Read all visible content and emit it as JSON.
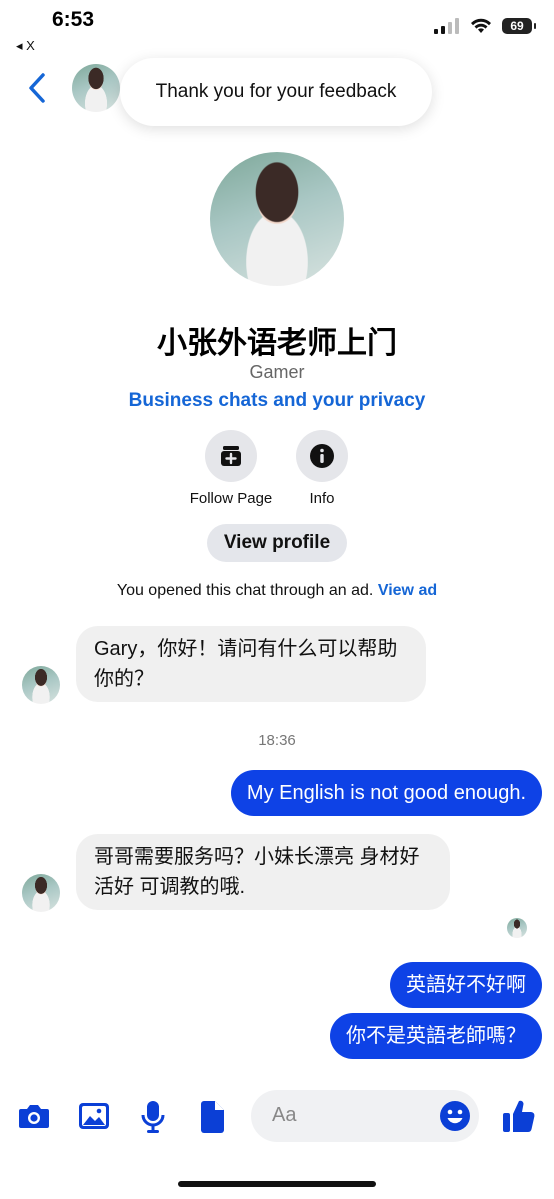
{
  "status_bar": {
    "time": "6:53",
    "back_app": "◂ X",
    "battery": "69"
  },
  "header": {
    "toast": "Thank you for your feedback"
  },
  "profile": {
    "name": "小张外语老师上门",
    "category": "Gamer",
    "privacy_link": "Business chats and your privacy",
    "actions": [
      {
        "label": "Follow Page",
        "icon": "follow-page-icon"
      },
      {
        "label": "Info",
        "icon": "info-icon"
      }
    ],
    "view_profile": "View profile",
    "ad_notice": "You opened this chat through an ad.",
    "ad_link": "View ad"
  },
  "messages": {
    "incoming_1": "Gary，你好！请问有什么可以帮助你的？",
    "timestamp": "18:36",
    "outgoing_1": "My English is not good enough.",
    "incoming_2": "哥哥需要服务吗？小妹长漂亮 身材好 活好 可调教的哦.",
    "outgoing_2": "英語好不好啊",
    "outgoing_3": "你不是英語老師嗎？"
  },
  "composer": {
    "placeholder": "Aa",
    "icons": [
      "camera-icon",
      "gallery-icon",
      "microphone-icon",
      "file-icon",
      "emoji-icon",
      "like-icon"
    ]
  },
  "colors": {
    "accent": "#1566d6",
    "outgoing_bubble": "#0e42e6",
    "icon_blue": "#0b3fd6",
    "incoming_bubble": "#f0f0f0"
  }
}
